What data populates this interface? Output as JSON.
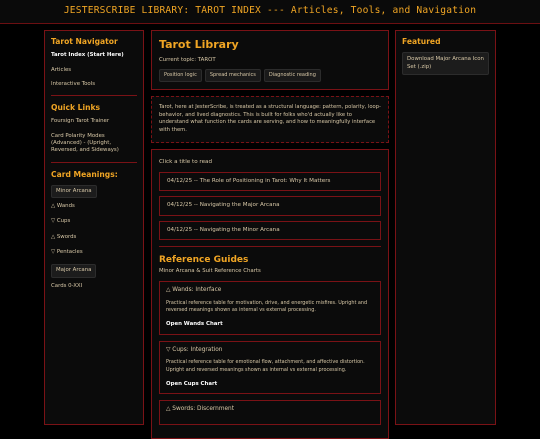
{
  "header": {
    "title": "JESTERSCRIBE LIBRARY: TAROT INDEX --- Articles, Tools, and Navigation"
  },
  "left": {
    "nav_title": "Tarot Navigator",
    "nav_items": [
      "Tarot Index (Start Here)",
      "Articles",
      "Interactive Tools"
    ],
    "quick_title": "Quick Links",
    "quick_items": [
      "Foursign Tarot Trainer",
      "Card Polarity Modes (Advanced) - (Upright, Reversed, and Sideways)"
    ],
    "meanings_title": "Card Meanings:",
    "major_label": "Minor Arcana",
    "suits": [
      "△ Wands",
      "▽ Cups",
      "△ Swords",
      "▽ Pentacles"
    ],
    "major2_label": "Major Arcana",
    "cards_range": "Cards 0-XXI"
  },
  "main": {
    "title": "Tarot Library",
    "topic": "Current topic: TAROT",
    "tags": [
      "Position logic",
      "Spread mechanics",
      "Diagnostic reading"
    ],
    "intro": "Tarot, here at JesterScribe, is treated as a structural language: pattern, polarity, loop-behavior, and lived diagnostics. This is built for folks who'd actually like to understand what function the cards are serving, and how to meaningfully interface with them.",
    "click_label": "Click a title to read",
    "articles": [
      "04/12/25 -- The Role of Positioning in Tarot: Why It Matters",
      "04/12/25 -- Navigating the Major Arcana",
      "04/12/25 -- Navigating the Minor Arcana"
    ],
    "ref_title": "Reference Guides",
    "ref_sub": "Minor Arcana & Suit Reference Charts",
    "cards": [
      {
        "title": "△ Wands: Interface",
        "desc": "Practical reference table for motivation, drive, and energetic misfires. Upright and reversed meanings shown as internal vs external processing.",
        "link": "Open Wands Chart"
      },
      {
        "title": "▽ Cups: Integration",
        "desc": "Practical reference table for emotional flow, attachment, and affective distortion. Upright and reversed meanings shown as internal vs external processing.",
        "link": "Open Cups Chart"
      },
      {
        "title": "△ Swords: Discernment",
        "desc": "",
        "link": ""
      }
    ]
  },
  "right": {
    "title": "Featured",
    "download": "Download Major Arcana Icon Set (.zip)"
  }
}
